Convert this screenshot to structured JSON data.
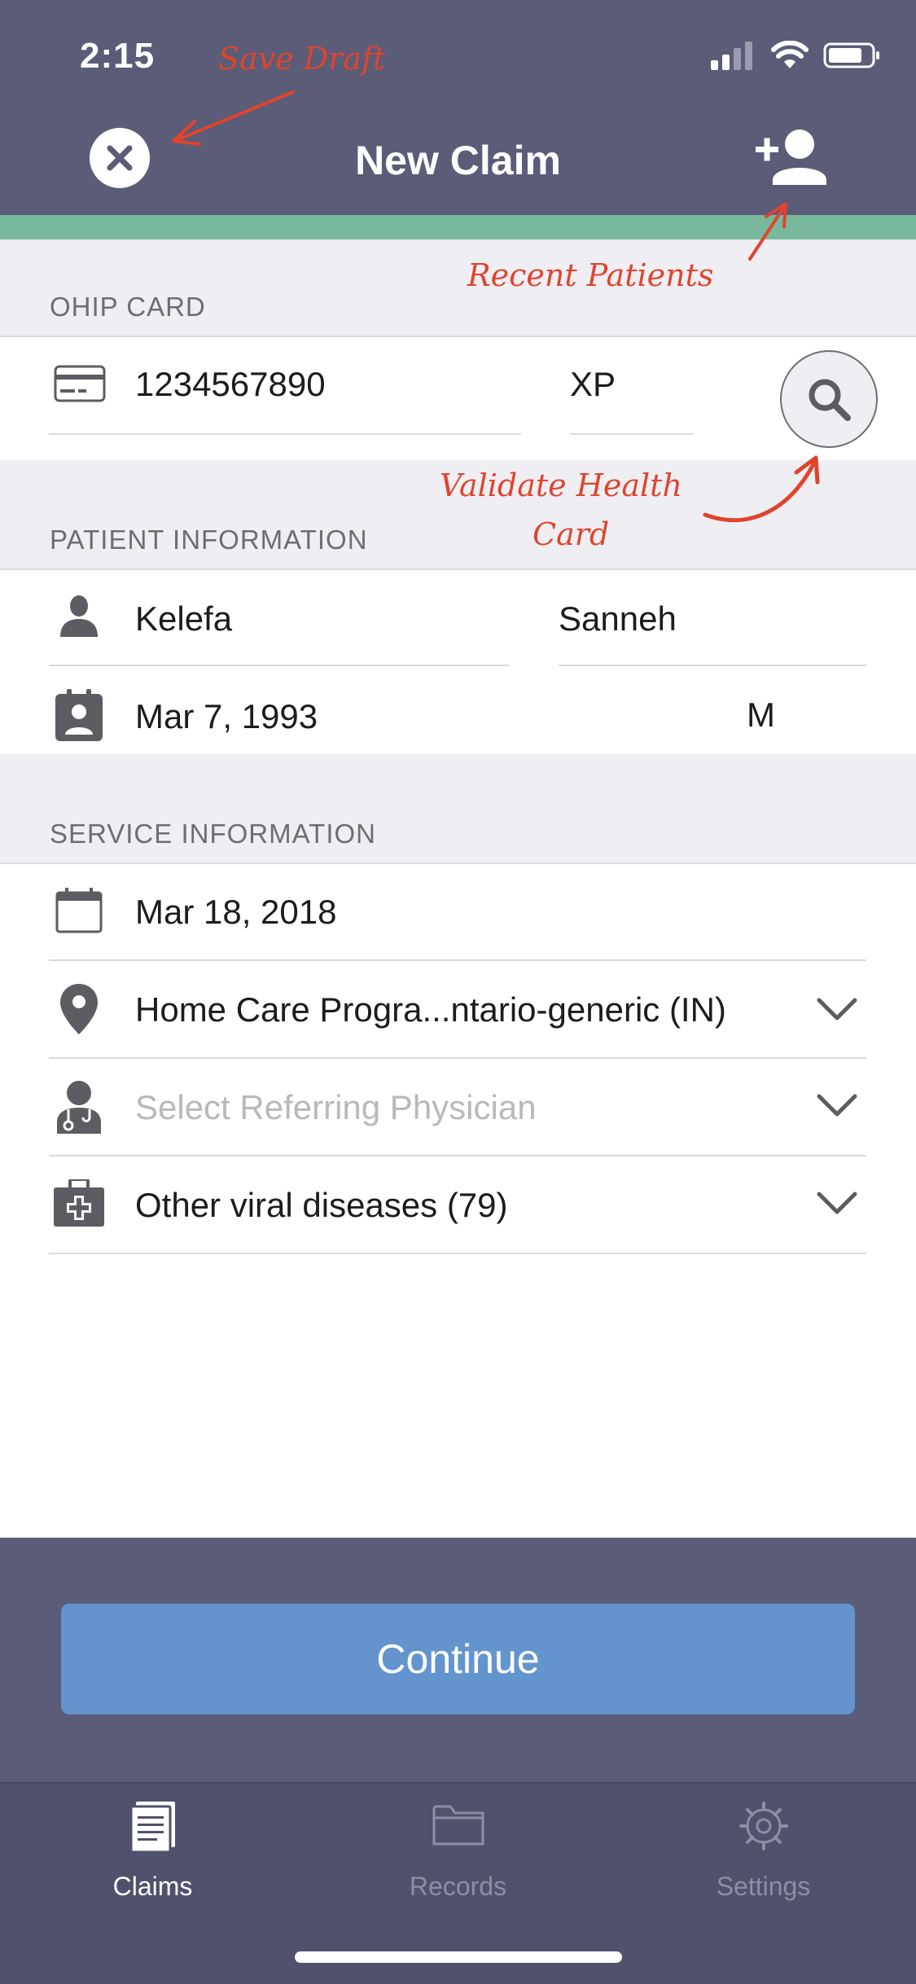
{
  "status_bar": {
    "time": "2:15"
  },
  "header": {
    "title": "New Claim"
  },
  "annotations": {
    "save_draft": "Save Draft",
    "recent_patients": "Recent Patients",
    "validate_line1": "Validate Health",
    "validate_line2": "Card"
  },
  "ohip_section": {
    "label": "OHIP CARD",
    "card_number": "1234567890",
    "version_code": "XP"
  },
  "patient_section": {
    "label": "PATIENT INFORMATION",
    "first_name": "Kelefa",
    "last_name": "Sanneh",
    "birth_date": "Mar 7, 1993",
    "sex": "M"
  },
  "service_section": {
    "label": "SERVICE INFORMATION",
    "service_date": "Mar 18, 2018",
    "location": "Home Care Progra...ntario-generic (IN)",
    "referring_physician_placeholder": "Select Referring Physician",
    "diagnosis": "Other viral diseases (79)"
  },
  "actions": {
    "continue_label": "Continue"
  },
  "tabs": [
    {
      "label": "Claims",
      "icon": "claims-icon",
      "active": true
    },
    {
      "label": "Records",
      "icon": "folder-icon",
      "active": false
    },
    {
      "label": "Settings",
      "icon": "gear-icon",
      "active": false
    }
  ],
  "colors": {
    "header_bg": "#5a5c78",
    "accent_green": "#78b99c",
    "continue_button": "#6494ce",
    "annotation_red": "#e0442d"
  }
}
